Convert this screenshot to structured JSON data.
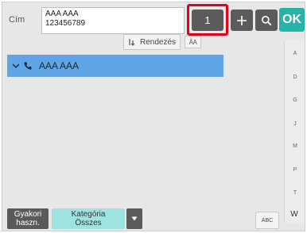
{
  "header": {
    "address_label": "Cím",
    "address_lines": [
      "AAA AAA",
      "123456789"
    ],
    "count": "1",
    "plus_icon": "plus-icon",
    "search_icon": "search-icon",
    "ok_label": "OK",
    "count_highlight_color": "#e4001b",
    "ok_color": "#27b4a8"
  },
  "sort": {
    "label": "Rendezés",
    "sort_icon": "sort-order-icon",
    "alt_label": "ÂA"
  },
  "list": {
    "items": [
      {
        "name": "AAA AAA",
        "expand_icon": "chevron-down-icon",
        "type_icon": "phone-icon",
        "selected": true
      }
    ],
    "selected_color": "#5fa5e6"
  },
  "index": {
    "letters": [
      "A",
      "D",
      "G",
      "J",
      "M",
      "P",
      "T"
    ],
    "last": "W"
  },
  "bottom": {
    "frequent_line1": "Gyakori",
    "frequent_line2": "haszn.",
    "category_line1": "Kategória",
    "category_line2": "Összes",
    "dropdown_icon": "caret-down-icon",
    "abc_label": "ABC"
  }
}
